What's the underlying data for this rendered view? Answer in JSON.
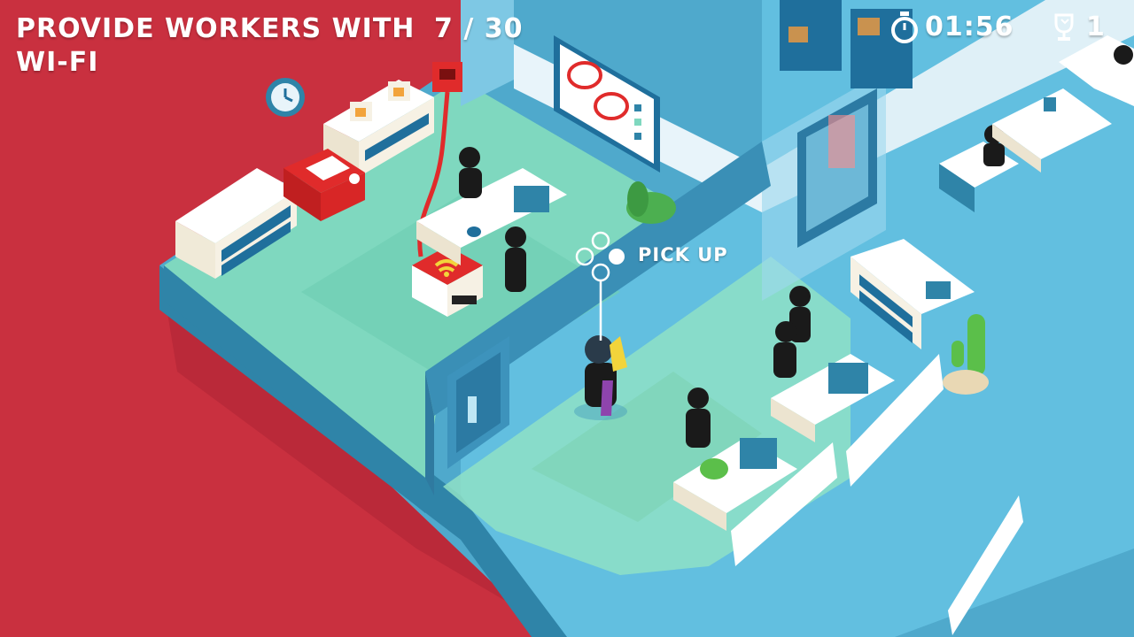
{
  "hud": {
    "objective": "PROVIDE WORKERS WITH WI-FI",
    "progress": "7 / 30",
    "timer": "01:56",
    "trophy_count": "1"
  },
  "prompt": {
    "action_label": "PICK UP",
    "icon": "controller-face-buttons-icon"
  },
  "icons": {
    "timer": "stopwatch-icon",
    "trophy": "trophy-icon"
  },
  "colors": {
    "background": "#c9303f",
    "floor_blue": "#5fb6d6",
    "wifi_zone": "#7dd6bd",
    "router_red": "#e02b2b",
    "wifi_signal": "#f2d43b",
    "furniture_white": "#f6f1e4",
    "accent_blue": "#1f6f9c"
  }
}
